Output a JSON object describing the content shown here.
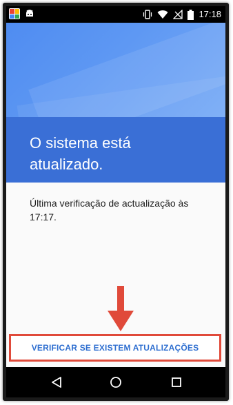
{
  "status_bar": {
    "time": "17:18",
    "icons_left": [
      "app-launcher-icon",
      "android-icon"
    ],
    "icons_right": [
      "vibrate-icon",
      "wifi-icon",
      "no-signal-icon",
      "battery-icon"
    ]
  },
  "header": {
    "title": "O sistema está atualizado.",
    "accent_light": "#5e98f3",
    "accent_dark": "#3a6fd6"
  },
  "content": {
    "last_check": "Última verificação de actualização às 17:17."
  },
  "action": {
    "check_button_label": "VERIFICAR SE EXISTEM ATUALIZAÇÕES",
    "highlight_color": "#e04a3a"
  },
  "nav_bar": {
    "buttons": [
      "back-icon",
      "home-icon",
      "recents-icon"
    ]
  }
}
